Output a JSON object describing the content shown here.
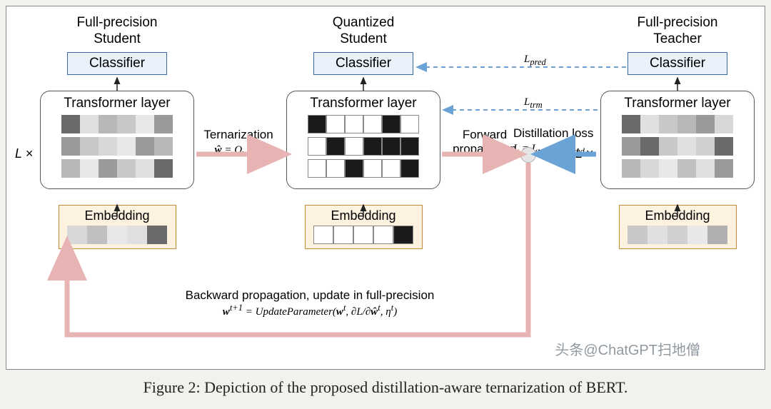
{
  "columns": {
    "left": {
      "title_line1": "Full-precision",
      "title_line2": "Student",
      "classifier": "Classifier",
      "transformer": "Transformer layer",
      "embedding": "Embedding"
    },
    "middle": {
      "title_line1": "Quantized",
      "title_line2": "Student",
      "classifier": "Classifier",
      "transformer": "Transformer layer",
      "embedding": "Embedding"
    },
    "right": {
      "title_line1": "Full-precision",
      "title_line2": "Teacher",
      "classifier": "Classifier",
      "transformer": "Transformer layer",
      "embedding": "Embedding"
    }
  },
  "labels": {
    "lx": "L ×",
    "ternarization": "Ternarization",
    "ternarization_formula": "ŵ = Q_w(w)",
    "forward": "Forward",
    "propagation": "propagation",
    "distillation": "Distillation loss",
    "distillation_formula": "L = L_trm + L_pred",
    "l_pred": "L_pred",
    "l_trm": "L_trm",
    "backward_line1": "Backward propagation, update in full-precision",
    "backward_formula": "w^(t+1) = UpdateParameter(w^t, ∂L/∂ŵ^t, η^t)"
  },
  "caption": "Figure 2: Depiction of the proposed distillation-aware ternarization of BERT.",
  "watermark": "头条@ChatGPT扫地僧",
  "colors": {
    "gray_light": "#e8e8e8",
    "gray_mid": "#cfcfcf",
    "gray_dark": "#9a9a9a",
    "gray_darker": "#6a6a6a",
    "black": "#1a1a1a",
    "white": "#ffffff",
    "pink_arrow": "#e8b3b3",
    "blue_arrow": "#6ba3d6",
    "blue_dash": "#6ba3d6"
  },
  "full_precision_rows": [
    [
      "#6a6a6a",
      "#e0e0e0",
      "#b8b8b8",
      "#c8c8c8",
      "#e8e8e8",
      "#9a9a9a"
    ],
    [
      "#9a9a9a",
      "#c8c8c8",
      "#d8d8d8",
      "#e8e8e8",
      "#9a9a9a",
      "#b8b8b8"
    ],
    [
      "#b8b8b8",
      "#e8e8e8",
      "#9a9a9a",
      "#c8c8c8",
      "#e0e0e0",
      "#6a6a6a"
    ]
  ],
  "full_precision_embed": [
    "#d8d8d8",
    "#c0c0c0",
    "#e8e8e8",
    "#e0e0e0",
    "#6a6a6a"
  ],
  "quantized_rows": [
    [
      "#1a1a1a",
      "#ffffff",
      "#ffffff",
      "#ffffff",
      "#1a1a1a",
      "#ffffff"
    ],
    [
      "#ffffff",
      "#1a1a1a",
      "#ffffff",
      "#1a1a1a",
      "#1a1a1a",
      "#1a1a1a"
    ],
    [
      "#ffffff",
      "#ffffff",
      "#1a1a1a",
      "#ffffff",
      "#ffffff",
      "#1a1a1a"
    ]
  ],
  "quantized_embed": [
    "#ffffff",
    "#ffffff",
    "#ffffff",
    "#ffffff",
    "#1a1a1a"
  ],
  "teacher_rows": [
    [
      "#6a6a6a",
      "#e0e0e0",
      "#c8c8c8",
      "#b8b8b8",
      "#9a9a9a",
      "#d8d8d8"
    ],
    [
      "#9a9a9a",
      "#6a6a6a",
      "#c8c8c8",
      "#e0e0e0",
      "#d0d0d0",
      "#6a6a6a"
    ],
    [
      "#b8b8b8",
      "#d8d8d8",
      "#e8e8e8",
      "#c0c0c0",
      "#e0e0e0",
      "#9a9a9a"
    ]
  ],
  "teacher_embed": [
    "#c8c8c8",
    "#e0e0e0",
    "#d0d0d0",
    "#e8e8e8",
    "#b0b0b0"
  ]
}
